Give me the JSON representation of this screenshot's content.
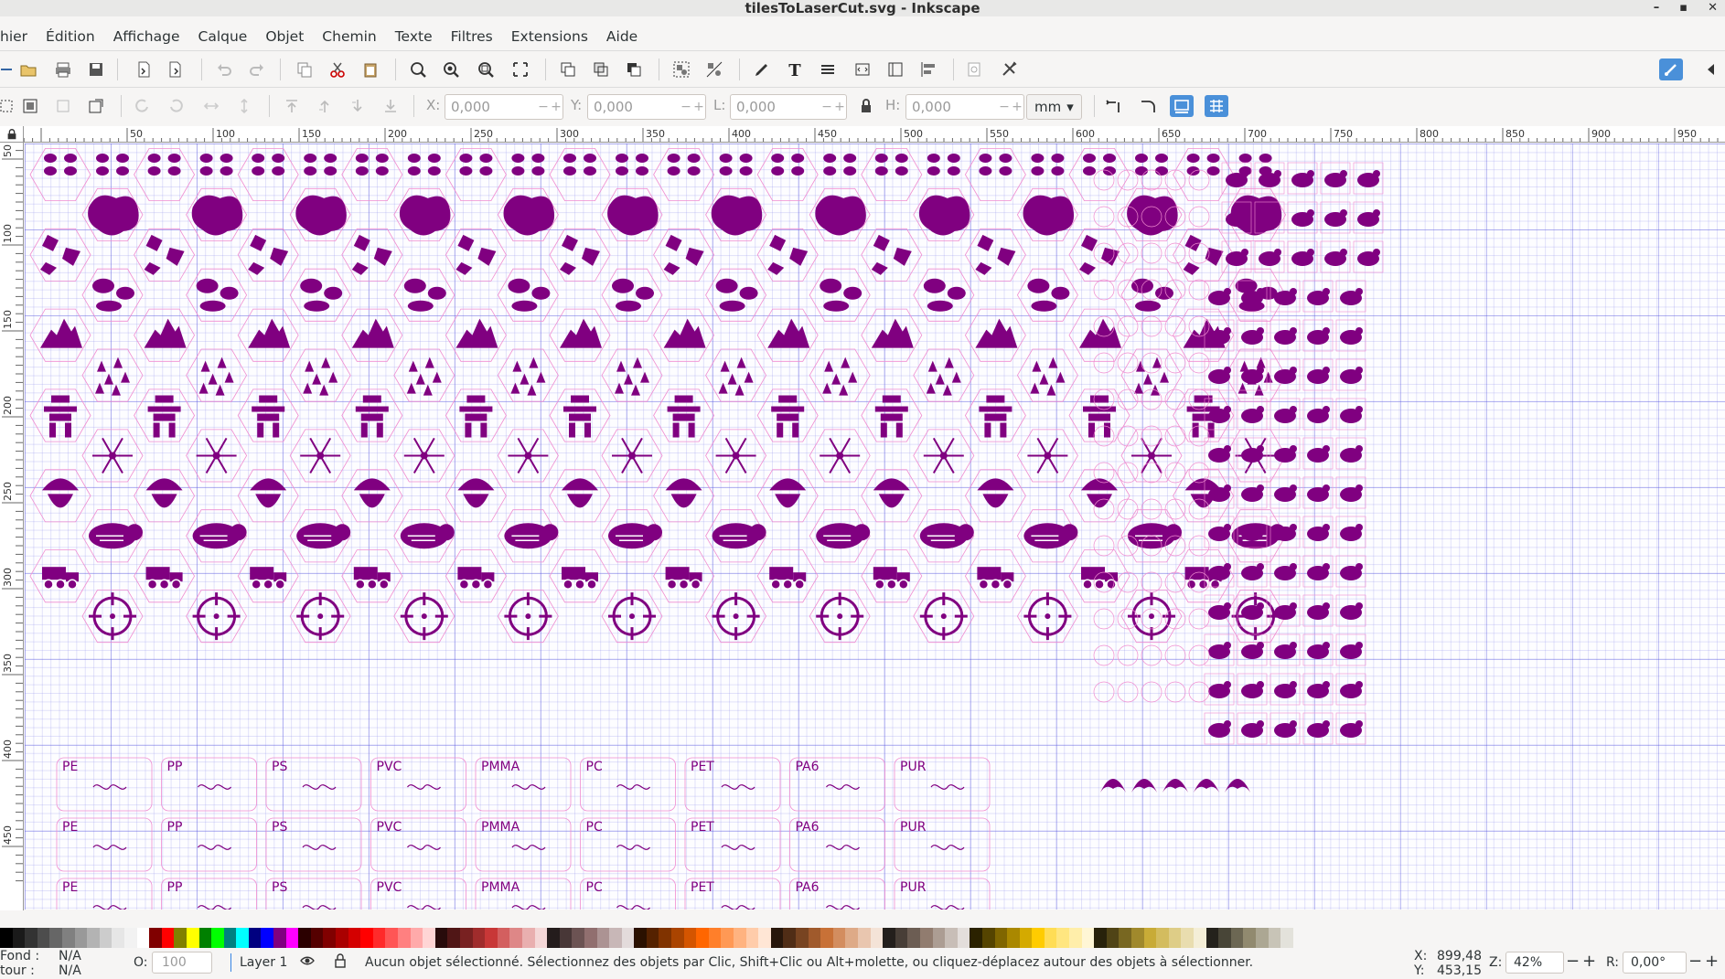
{
  "window": {
    "title": "tilesToLaserCut.svg - Inkscape",
    "controls": [
      "–",
      "▪",
      "✕"
    ]
  },
  "menu": [
    "hier",
    "Édition",
    "Affichage",
    "Calque",
    "Objet",
    "Chemin",
    "Texte",
    "Filtres",
    "Extensions",
    "Aide"
  ],
  "toolctrl": {
    "x_label": "X:",
    "x_value": "0,000",
    "y_label": "Y:",
    "y_value": "0,000",
    "w_label": "L:",
    "w_value": "0,000",
    "h_label": "H:",
    "h_value": "0,000",
    "unit": "mm"
  },
  "ruler": {
    "h_labels": [
      "50",
      "100",
      "150",
      "200",
      "250",
      "300",
      "350",
      "400",
      "450",
      "500",
      "550",
      "600",
      "650",
      "700",
      "750",
      "800",
      "850",
      "900",
      "950"
    ],
    "v_labels": [
      "50",
      "100",
      "150",
      "200",
      "250",
      "300",
      "350",
      "400",
      "450"
    ]
  },
  "plastic_codes": [
    "PE",
    "PP",
    "PS",
    "PVC",
    "PMMA",
    "PC",
    "PET",
    "PA6",
    "PUR"
  ],
  "palette_colors": [
    "#000000",
    "#1a1a1a",
    "#333333",
    "#4d4d4d",
    "#666666",
    "#808080",
    "#999999",
    "#b3b3b3",
    "#cccccc",
    "#e6e6e6",
    "#f2f2f2",
    "#ffffff",
    "#800000",
    "#ff0000",
    "#808000",
    "#ffff00",
    "#008000",
    "#00ff00",
    "#008080",
    "#00ffff",
    "#000080",
    "#0000ff",
    "#800080",
    "#ff00ff",
    "#2b0000",
    "#550000",
    "#800000",
    "#aa0000",
    "#d40000",
    "#ff0000",
    "#ff2a2a",
    "#ff5555",
    "#ff8080",
    "#ffaaaa",
    "#ffd5d5",
    "#280b0b",
    "#501616",
    "#782121",
    "#a02c2c",
    "#c83737",
    "#d35f5f",
    "#de8787",
    "#e9afaf",
    "#f4d7d7",
    "#241c1c",
    "#483737",
    "#6c5353",
    "#916f6f",
    "#ac9393",
    "#c8b7b7",
    "#e3dbdb",
    "#2b1100",
    "#552200",
    "#803300",
    "#aa4400",
    "#d45500",
    "#ff6600",
    "#ff7f2a",
    "#ff9955",
    "#ffb380",
    "#ffccaa",
    "#ffe6d5",
    "#28170b",
    "#502d16",
    "#784421",
    "#a05a2c",
    "#c87137",
    "#d38d5f",
    "#deaa87",
    "#e9c6af",
    "#f4e3d7",
    "#241f1c",
    "#483e37",
    "#6c5d53",
    "#917c6f",
    "#ac9d93",
    "#c8beb7",
    "#e3dedb",
    "#2b2200",
    "#554400",
    "#806600",
    "#aa8800",
    "#d4aa00",
    "#ffcc00",
    "#ffdd55",
    "#ffe680",
    "#ffeeaa",
    "#fff6d5",
    "#28220b",
    "#504416",
    "#786721",
    "#a0892c",
    "#c8ab37",
    "#d3bc5f",
    "#decd87",
    "#e9ddaf",
    "#f4eed7",
    "#24221c",
    "#484537",
    "#6c6753",
    "#918a6f",
    "#aca793",
    "#c8c4b7",
    "#e3e2db"
  ],
  "status": {
    "fill_label": "Fond :",
    "fill_value": "N/A",
    "stroke_label": "tour :",
    "stroke_value": "N/A",
    "opacity_label": "O:",
    "opacity_value": "100",
    "layer": "Layer 1",
    "message": "Aucun objet sélectionné. Sélectionnez des objets par Clic, Shift+Clic ou Alt+molette, ou cliquez-déplacez autour des objets à sélectionner.",
    "x_label": "X:",
    "x_value": "899,48",
    "y_label": "Y:",
    "y_value": "453,15",
    "zoom_label": "Z:",
    "zoom_value": "42%",
    "rot_label": "R:",
    "rot_value": "0,00°"
  },
  "icons": {
    "tile_motifs": [
      "paw-icon",
      "lake-icon",
      "rocks-icon",
      "stones-icon",
      "mountain-icon",
      "forest-icon",
      "inukshuk-icon",
      "snowflake-icon",
      "mask-icon",
      "animal-icon",
      "truck-icon",
      "target-icon",
      "oil-derrick-icon",
      "radiation-icon",
      "snowflake-variant-icon"
    ],
    "right_motifs": [
      "whale-icon",
      "walrus-icon",
      "seal-icon",
      "bear-icon",
      "fox-icon",
      "caribou-icon",
      "fish-icon",
      "bird-icon",
      "squid-icon",
      "owl-icon",
      "shrimp-icon",
      "crab-icon",
      "dolphin-icon",
      "narwhal-icon",
      "flower-icon",
      "fang-icon"
    ]
  }
}
